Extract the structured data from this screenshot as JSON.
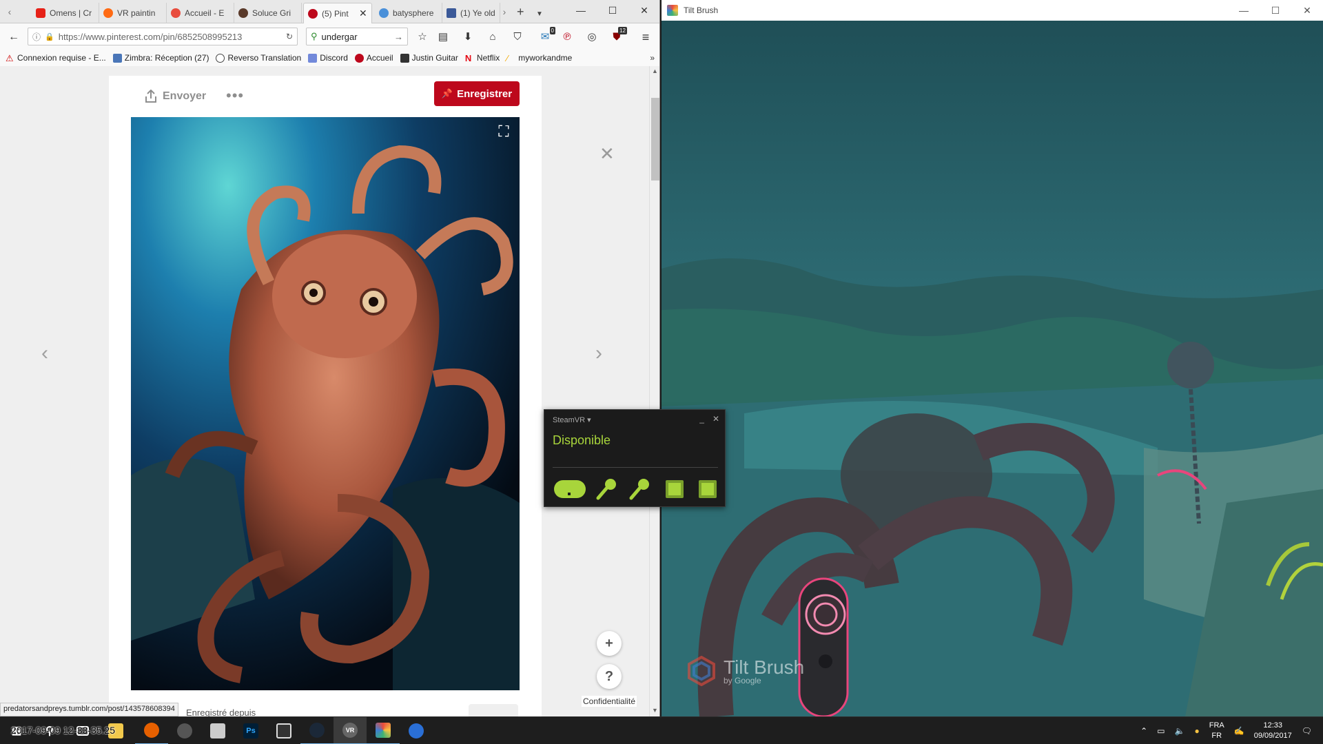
{
  "browser": {
    "tabs": [
      {
        "label": "Omens | Cr",
        "fav_color": "#e62117"
      },
      {
        "label": "VR paintin",
        "fav_color": "#ff6a13"
      },
      {
        "label": "Accueil - E",
        "fav_color": "#e84c3d"
      },
      {
        "label": "Soluce Gri",
        "fav_color": "#5a3a2a"
      },
      {
        "label": "(5) Pint",
        "fav_color": "#bd081c"
      },
      {
        "label": "batysphere",
        "fav_color": "#4a90d9"
      },
      {
        "label": "(1) Ye old",
        "fav_color": "#3b5998"
      }
    ],
    "url": "https://www.pinterest.com/pin/6852508995213",
    "search_value": "undergar",
    "badges": {
      "mail": "0",
      "ublock": "12"
    },
    "bookmarks": [
      {
        "label": "Connexion requise - E...",
        "color": "#cc0000"
      },
      {
        "label": "Zimbra: Réception (27)",
        "color": "#4a76b8"
      },
      {
        "label": "Reverso Translation",
        "color": "#444444"
      },
      {
        "label": "Discord",
        "color": "#7289da"
      },
      {
        "label": "Accueil",
        "color": "#bd081c"
      },
      {
        "label": "Justin Guitar",
        "color": "#333333"
      },
      {
        "label": "Netflix",
        "color": "#e50914"
      },
      {
        "label": "myworkandme",
        "color": "#f2a900"
      }
    ],
    "overflow_label": "»"
  },
  "pin": {
    "send_label": "Envoyer",
    "more_label": "•••",
    "save_label": "Enregistrer",
    "privacy_label": "Confidentialité",
    "footer_text": "Enregistré depuis",
    "status_url": "predatorsandpreys.tumblr.com/post/143578608394",
    "zoom_in": "+",
    "help": "?"
  },
  "tiltbrush": {
    "window_title": "Tilt Brush",
    "watermark_title": "Tilt Brush",
    "watermark_sub": "by Google"
  },
  "steamvr": {
    "title": "SteamVR ▾",
    "status": "Disponible",
    "status_color": "#a8d53b"
  },
  "taskbar": {
    "overlay_text": "2017-09-09 12-33-35.25",
    "apps": [
      "Firefox",
      "Steam client",
      "Tilt-app",
      "Photoshop",
      "Film",
      "Steam",
      "SteamVR",
      "Tilt Brush",
      "Compass"
    ],
    "lang_top": "FRA",
    "lang_bottom": "FR",
    "time": "12:33",
    "date": "09/09/2017"
  },
  "colors": {
    "pinterest_red": "#bd081c",
    "tiltbrush_sky": "#2c6b73",
    "steamvr_green": "#a8d53b",
    "taskbar": "#1e1e1e"
  }
}
